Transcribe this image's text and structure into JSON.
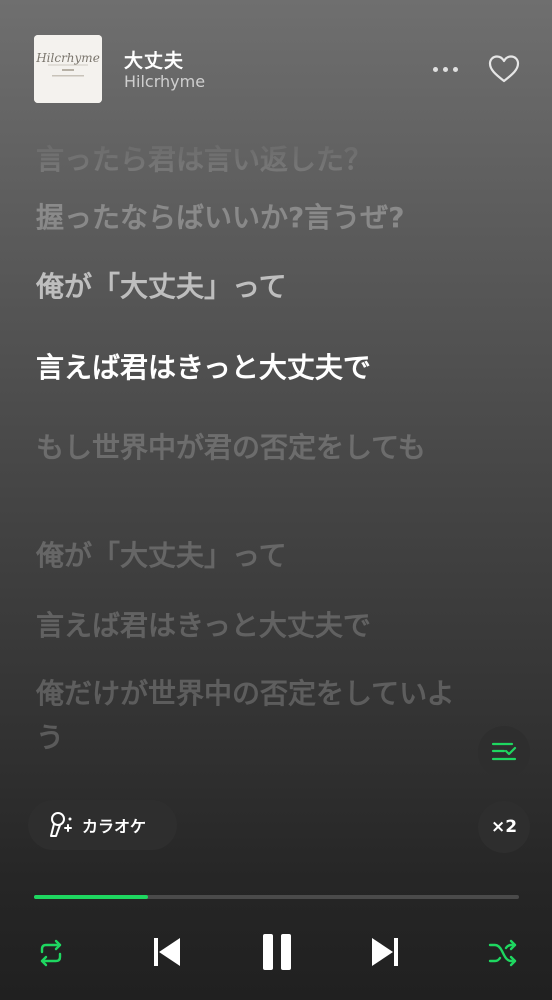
{
  "header": {
    "song_title": "大丈夫",
    "artist": "Hilcrhyme",
    "album_art_text": "Hilcrhyme"
  },
  "lyrics": {
    "lines": [
      {
        "text": "握ったならばいいか?言うぜ?",
        "state": "past"
      },
      {
        "text": "俺が「大丈夫」って",
        "state": "prev"
      },
      {
        "text": "言えば君はきっと大丈夫で",
        "state": "current"
      },
      {
        "text": "もし世界中が君の否定をしても",
        "state": "upcoming"
      },
      {
        "text": "俺が「大丈夫」って",
        "state": "upcoming"
      },
      {
        "text": "言えば君はきっと大丈夫で",
        "state": "upcoming"
      },
      {
        "text": "俺だけが世界中の否定をしていよう",
        "state": "upcoming"
      }
    ]
  },
  "controls": {
    "karaoke_label": "カラオケ",
    "speed_label": "×2",
    "progress_fraction": 0.235
  },
  "icons": {
    "more": "more-dots-icon",
    "like": "heart-icon",
    "queue": "lyrics-queue-icon",
    "karaoke": "microphone-sparkle-icon",
    "repeat": "repeat-icon",
    "previous": "skip-previous-icon",
    "pause": "pause-icon",
    "next": "skip-next-icon",
    "shuffle": "shuffle-icon"
  },
  "colors": {
    "accent": "#1ed760",
    "text_primary": "#ffffff",
    "text_secondary": "#cfcfcf"
  }
}
